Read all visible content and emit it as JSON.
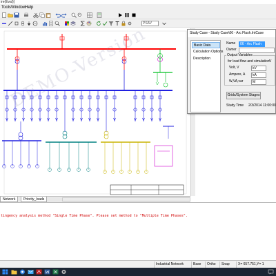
{
  "window": {
    "title": "ire(Eval)]"
  },
  "menu": {
    "items": [
      "Tools",
      "Window",
      "Help"
    ]
  },
  "toolbar": {
    "combo_value": "PSAV",
    "icon_names": [
      "new-icon",
      "open-icon",
      "save-icon",
      "print-icon",
      "cut-icon",
      "copy-icon",
      "paste-icon",
      "undo-icon",
      "redo-icon",
      "zoom-in-icon",
      "zoom-out-icon",
      "grid-icon",
      "calculate-icon",
      "run-icon",
      "pause-icon",
      "stop-icon",
      "chart-icon",
      "report-icon"
    ]
  },
  "canvas": {
    "watermark": "DEMO-Version"
  },
  "dialog": {
    "title": "Study Case - Study Case\\06 - Arc Flash.IntCase",
    "nav_items": [
      "Basic Data",
      "Calculation Options",
      "Description"
    ],
    "name_label": "Name",
    "name_value": "06 - Arc Flash",
    "owner_label": "Owner",
    "output_variables_label": "Output Variables",
    "load_flow_label": "for load flow and simulation",
    "volt_label": "Volt, V",
    "volt_value": "kV",
    "ampere_label": "Ampere, A",
    "ampere_value": "kA",
    "w_label": "W,VA,var",
    "w_value": "M",
    "right_col_label": "V",
    "grids_button": "Grids/System Stages",
    "study_time_label": "Study Time",
    "study_time_value": "2/3/2014 11:00:00"
  },
  "tabs": {
    "items": [
      "Network",
      "Priority_loads"
    ]
  },
  "output": {
    "message": "tingency analysis method \"Single Time Phase\". Please set method to \"Multiple Time Phases\"."
  },
  "statusbar": {
    "network": "Industrial Network",
    "base": "Base",
    "ortho": "Ortho",
    "snap": "Snap",
    "coords": "X= 657.751,Y= 1"
  },
  "colors": {
    "red_bus": "#ff0000",
    "blue_bus": "#2020e0",
    "green_sub": "#00c020",
    "yellow_sub": "#c8b400",
    "teal_sub": "#008080",
    "magenta": "#d000d0",
    "error_text": "#d00000",
    "selection": "#3399ff"
  }
}
